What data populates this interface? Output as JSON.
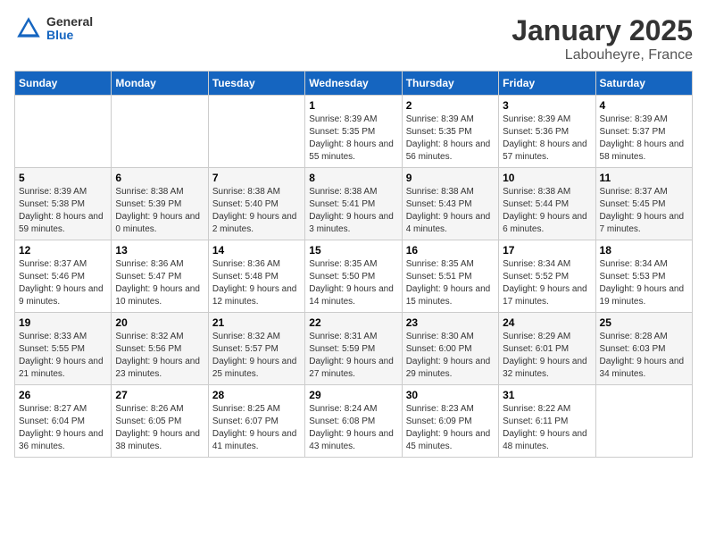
{
  "logo": {
    "general": "General",
    "blue": "Blue"
  },
  "title": "January 2025",
  "subtitle": "Labouheyre, France",
  "weekdays": [
    "Sunday",
    "Monday",
    "Tuesday",
    "Wednesday",
    "Thursday",
    "Friday",
    "Saturday"
  ],
  "weeks": [
    [
      {
        "day": "",
        "info": ""
      },
      {
        "day": "",
        "info": ""
      },
      {
        "day": "",
        "info": ""
      },
      {
        "day": "1",
        "info": "Sunrise: 8:39 AM\nSunset: 5:35 PM\nDaylight: 8 hours and 55 minutes."
      },
      {
        "day": "2",
        "info": "Sunrise: 8:39 AM\nSunset: 5:35 PM\nDaylight: 8 hours and 56 minutes."
      },
      {
        "day": "3",
        "info": "Sunrise: 8:39 AM\nSunset: 5:36 PM\nDaylight: 8 hours and 57 minutes."
      },
      {
        "day": "4",
        "info": "Sunrise: 8:39 AM\nSunset: 5:37 PM\nDaylight: 8 hours and 58 minutes."
      }
    ],
    [
      {
        "day": "5",
        "info": "Sunrise: 8:39 AM\nSunset: 5:38 PM\nDaylight: 8 hours and 59 minutes."
      },
      {
        "day": "6",
        "info": "Sunrise: 8:38 AM\nSunset: 5:39 PM\nDaylight: 9 hours and 0 minutes."
      },
      {
        "day": "7",
        "info": "Sunrise: 8:38 AM\nSunset: 5:40 PM\nDaylight: 9 hours and 2 minutes."
      },
      {
        "day": "8",
        "info": "Sunrise: 8:38 AM\nSunset: 5:41 PM\nDaylight: 9 hours and 3 minutes."
      },
      {
        "day": "9",
        "info": "Sunrise: 8:38 AM\nSunset: 5:43 PM\nDaylight: 9 hours and 4 minutes."
      },
      {
        "day": "10",
        "info": "Sunrise: 8:38 AM\nSunset: 5:44 PM\nDaylight: 9 hours and 6 minutes."
      },
      {
        "day": "11",
        "info": "Sunrise: 8:37 AM\nSunset: 5:45 PM\nDaylight: 9 hours and 7 minutes."
      }
    ],
    [
      {
        "day": "12",
        "info": "Sunrise: 8:37 AM\nSunset: 5:46 PM\nDaylight: 9 hours and 9 minutes."
      },
      {
        "day": "13",
        "info": "Sunrise: 8:36 AM\nSunset: 5:47 PM\nDaylight: 9 hours and 10 minutes."
      },
      {
        "day": "14",
        "info": "Sunrise: 8:36 AM\nSunset: 5:48 PM\nDaylight: 9 hours and 12 minutes."
      },
      {
        "day": "15",
        "info": "Sunrise: 8:35 AM\nSunset: 5:50 PM\nDaylight: 9 hours and 14 minutes."
      },
      {
        "day": "16",
        "info": "Sunrise: 8:35 AM\nSunset: 5:51 PM\nDaylight: 9 hours and 15 minutes."
      },
      {
        "day": "17",
        "info": "Sunrise: 8:34 AM\nSunset: 5:52 PM\nDaylight: 9 hours and 17 minutes."
      },
      {
        "day": "18",
        "info": "Sunrise: 8:34 AM\nSunset: 5:53 PM\nDaylight: 9 hours and 19 minutes."
      }
    ],
    [
      {
        "day": "19",
        "info": "Sunrise: 8:33 AM\nSunset: 5:55 PM\nDaylight: 9 hours and 21 minutes."
      },
      {
        "day": "20",
        "info": "Sunrise: 8:32 AM\nSunset: 5:56 PM\nDaylight: 9 hours and 23 minutes."
      },
      {
        "day": "21",
        "info": "Sunrise: 8:32 AM\nSunset: 5:57 PM\nDaylight: 9 hours and 25 minutes."
      },
      {
        "day": "22",
        "info": "Sunrise: 8:31 AM\nSunset: 5:59 PM\nDaylight: 9 hours and 27 minutes."
      },
      {
        "day": "23",
        "info": "Sunrise: 8:30 AM\nSunset: 6:00 PM\nDaylight: 9 hours and 29 minutes."
      },
      {
        "day": "24",
        "info": "Sunrise: 8:29 AM\nSunset: 6:01 PM\nDaylight: 9 hours and 32 minutes."
      },
      {
        "day": "25",
        "info": "Sunrise: 8:28 AM\nSunset: 6:03 PM\nDaylight: 9 hours and 34 minutes."
      }
    ],
    [
      {
        "day": "26",
        "info": "Sunrise: 8:27 AM\nSunset: 6:04 PM\nDaylight: 9 hours and 36 minutes."
      },
      {
        "day": "27",
        "info": "Sunrise: 8:26 AM\nSunset: 6:05 PM\nDaylight: 9 hours and 38 minutes."
      },
      {
        "day": "28",
        "info": "Sunrise: 8:25 AM\nSunset: 6:07 PM\nDaylight: 9 hours and 41 minutes."
      },
      {
        "day": "29",
        "info": "Sunrise: 8:24 AM\nSunset: 6:08 PM\nDaylight: 9 hours and 43 minutes."
      },
      {
        "day": "30",
        "info": "Sunrise: 8:23 AM\nSunset: 6:09 PM\nDaylight: 9 hours and 45 minutes."
      },
      {
        "day": "31",
        "info": "Sunrise: 8:22 AM\nSunset: 6:11 PM\nDaylight: 9 hours and 48 minutes."
      },
      {
        "day": "",
        "info": ""
      }
    ]
  ]
}
